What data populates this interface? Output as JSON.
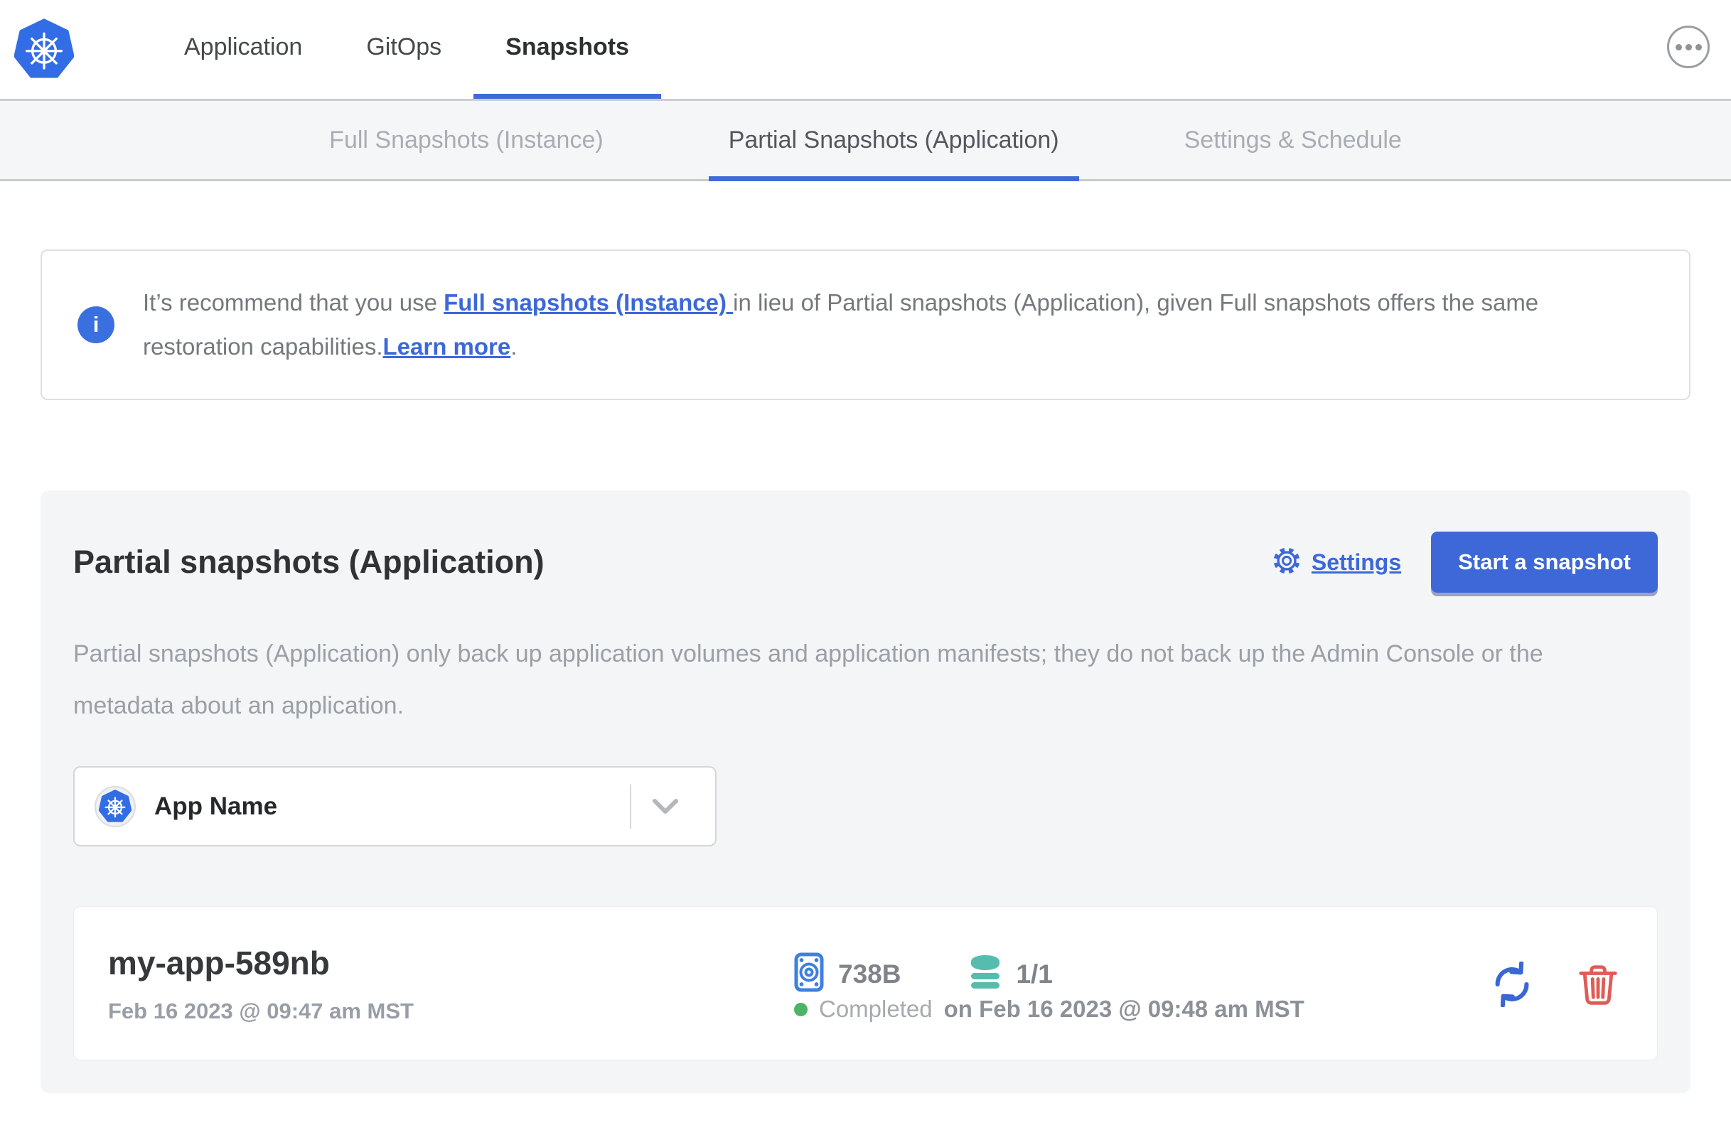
{
  "nav": {
    "tabs": [
      {
        "label": "Application"
      },
      {
        "label": "GitOps"
      },
      {
        "label": "Snapshots"
      }
    ]
  },
  "subtabs": [
    {
      "label": "Full Snapshots (Instance)"
    },
    {
      "label": "Partial Snapshots (Application)"
    },
    {
      "label": "Settings & Schedule"
    }
  ],
  "banner": {
    "text_before": "It’s recommend that you use ",
    "link_full": "Full snapshots (Instance) ",
    "text_middle": "in lieu of Partial snapshots (Application), given Full snapshots offers the same restoration capabilities.",
    "link_learn": "Learn more",
    "text_after": "."
  },
  "main": {
    "title": "Partial snapshots (Application)",
    "settings_label": "Settings",
    "start_button_label": "Start a snapshot",
    "description": "Partial snapshots (Application) only back up application volumes and application manifests; they do not back up the Admin Console or the metadata about an application.",
    "app_selector": {
      "value": "App Name"
    },
    "snapshots": [
      {
        "name": "my-app-589nb",
        "started": "Feb 16 2023 @ 09:47 am MST",
        "size": "738B",
        "volumes": "1/1",
        "status": "Completed",
        "finished": "on Feb 16 2023 @ 09:48 am MST"
      }
    ]
  },
  "icons": {
    "logo": "kubernetes-logo",
    "menu": "ellipsis-menu-icon",
    "info": "info-icon",
    "settings": "gear-icon",
    "app": "kubernetes-app-icon",
    "chevron": "chevron-down-icon",
    "size": "disk-volume-icon",
    "volumes": "database-icon",
    "restore": "restore-icon",
    "delete": "trash-icon"
  },
  "colors": {
    "accent_blue": "#3e68d7",
    "kubernetes_blue": "#326de6",
    "teal": "#56bdae",
    "success_green": "#4cb464",
    "danger_red": "#e15b55",
    "card_bg": "#f4f5f7",
    "subtab_bg": "#f5f6f8",
    "text_dark": "#303236",
    "text_gray": "#9b9fa6"
  }
}
